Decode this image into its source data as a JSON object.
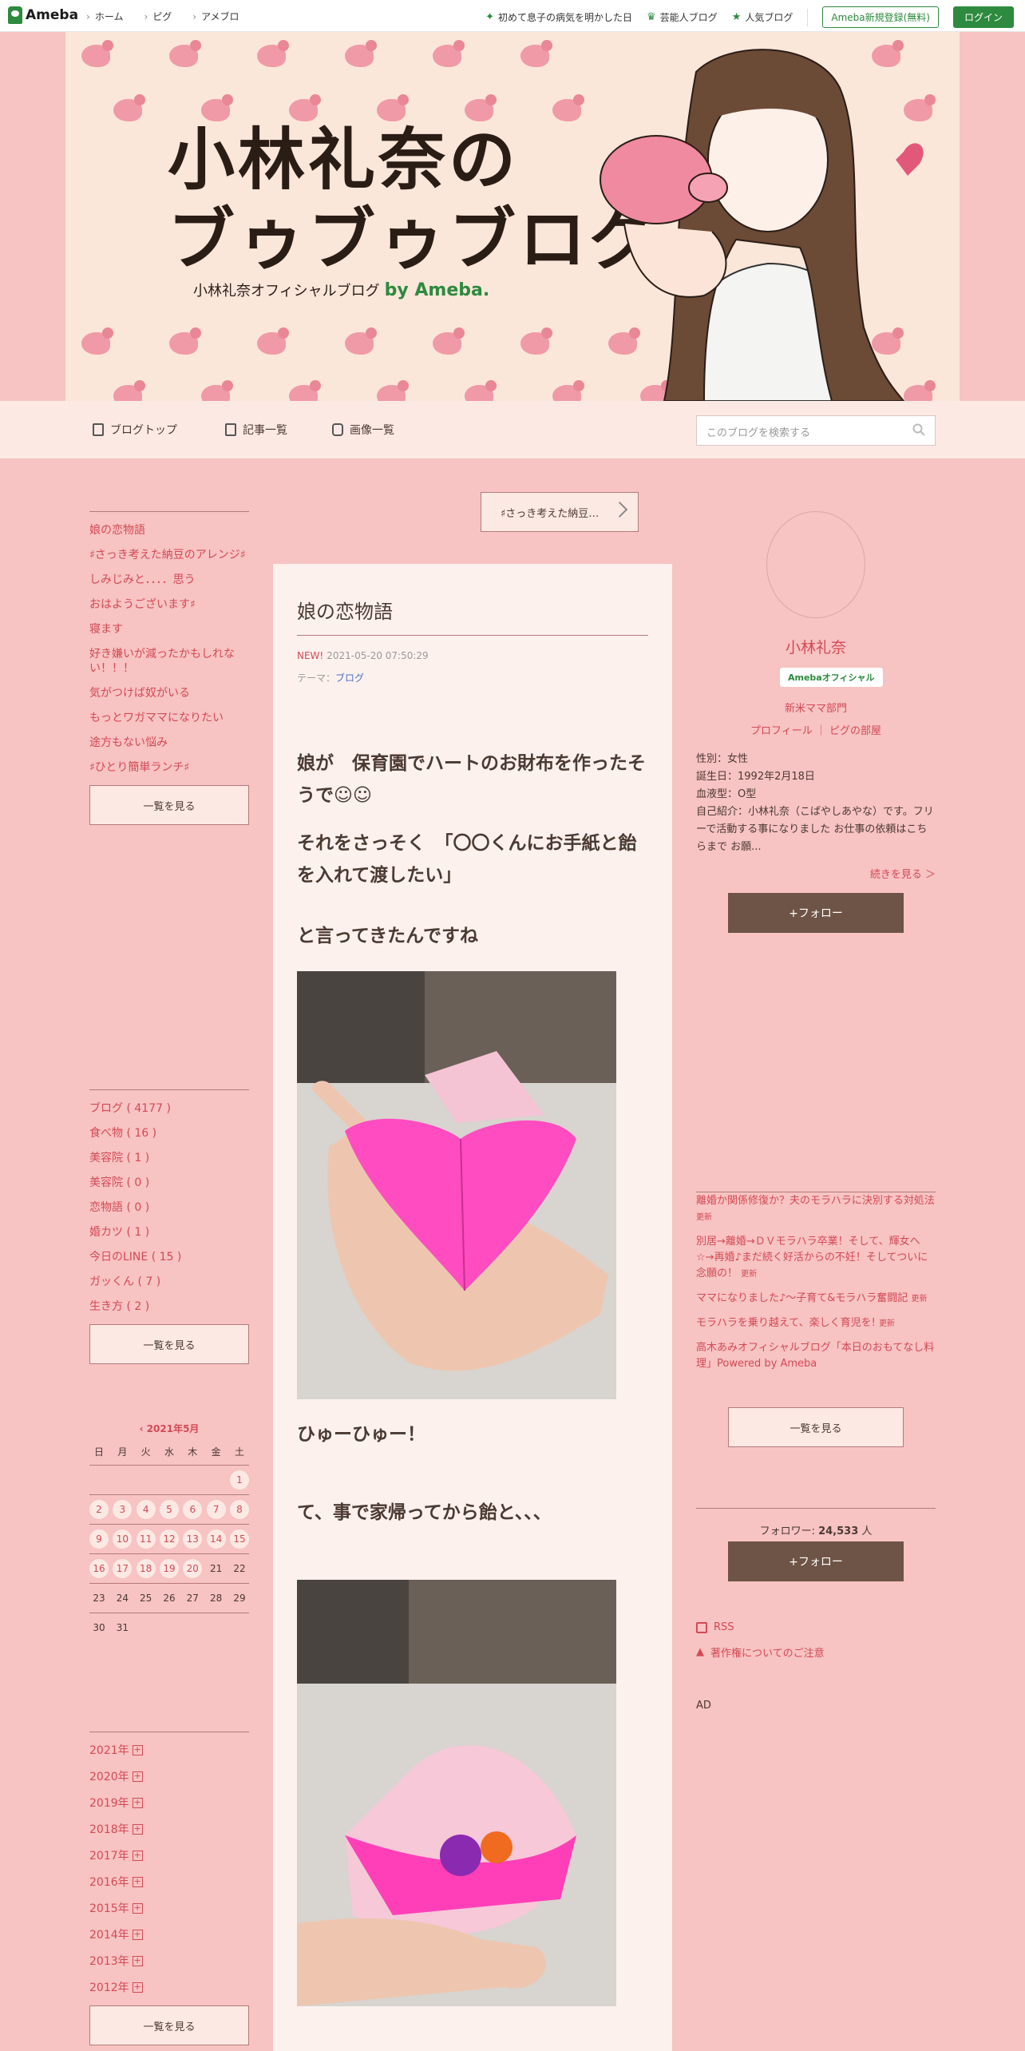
{
  "topbar": {
    "logo": "Ameba",
    "nav": [
      "ホーム",
      "ピグ",
      "アメブロ"
    ],
    "links": [
      "初めて息子の病気を明かした日",
      "芸能人ブログ",
      "人気ブログ"
    ],
    "register": "Ameba新規登録(無料)",
    "login": "ログイン"
  },
  "header": {
    "title_line1": "小林礼奈の",
    "title_line2": "ブゥブゥブログ",
    "subtitle": "小林礼奈オフィシャルブログ",
    "by": "by Ameba."
  },
  "nav": {
    "items": [
      "ブログトップ",
      "記事一覧",
      "画像一覧"
    ],
    "search_placeholder": "このブログを検索する"
  },
  "left": {
    "recent": [
      "娘の恋物語",
      "♯さっき考えた納豆のアレンジ♯",
      "しみじみと．．．．思う",
      "おはようございます♯",
      "寝ます",
      "好き嫌いが減ったかもしれない！！！",
      "気がつけば奴がいる",
      "もっとワガママになりたい",
      "途方もない悩み",
      "♯ひとり簡単ランチ♯"
    ],
    "more1": "一覧を見る",
    "themes": [
      "ブログ ( 4177 )",
      "食べ物 ( 16 )",
      "美容院 ( 1 )",
      "美容院 ( 0 )",
      "恋物語 ( 0 )",
      "婚カツ ( 1 )",
      "今日のLINE ( 15 )",
      "ガッくん ( 7 )",
      "生き方 ( 2 )"
    ],
    "more2": "一覧を見る",
    "calendar": {
      "title": "2021年5月",
      "days": [
        "日",
        "月",
        "火",
        "水",
        "木",
        "金",
        "土"
      ],
      "weeks": [
        [
          "",
          "",
          "",
          "",
          "",
          "",
          "1"
        ],
        [
          "2",
          "3",
          "4",
          "5",
          "6",
          "7",
          "8"
        ],
        [
          "9",
          "10",
          "11",
          "12",
          "13",
          "14",
          "15"
        ],
        [
          "16",
          "17",
          "18",
          "19",
          "20",
          "21",
          "22"
        ],
        [
          "23",
          "24",
          "25",
          "26",
          "27",
          "28",
          "29"
        ],
        [
          "30",
          "31",
          "",
          "",
          "",
          "",
          ""
        ]
      ]
    },
    "archive": [
      "2021年",
      "2020年",
      "2019年",
      "2018年",
      "2017年",
      "2016年",
      "2015年",
      "2014年",
      "2013年",
      "2012年"
    ],
    "more3": "一覧を見る"
  },
  "main": {
    "pager": "♯さっき考えた納豆…",
    "title": "娘の恋物語",
    "new_label": "NEW!",
    "date": "2021-05-20 07:50:29",
    "theme_label": "テーマ：",
    "theme": "ブログ",
    "p1": "娘が　保育園でハートのお財布を作ったそうで☺☺",
    "p2": "それをさっそく　「〇〇くんにお手紙と飴を入れて渡したい」",
    "p3": "と言ってきたんですね",
    "p4": "ひゅーひゅー！",
    "p5": "て、事で家帰ってから飴と、、、"
  },
  "right": {
    "name": "小林礼奈",
    "badge": "Amebaオフィシャル",
    "genre": "新米ママ部門",
    "links": "プロフィール ｜ ピグの部屋",
    "profile": [
      "性別：女性",
      "誕生日：1992年2月18日",
      "血液型：O型",
      "自己紹介：小林礼奈（こばやしあやな）です。フリーで活動する事になりました お仕事の依頼はこちらまで お願..."
    ],
    "more": "続きを見る ＞",
    "follow": "+フォロー",
    "recommend": [
      {
        "t": "離婚か関係修復か？夫のモラハラに決別する対処法",
        "u": "更新"
      },
      {
        "t": "別居→離婚→ＤＶモラハラ卒業！そして、輝女へ☆→再婚♪まだ続く好活からの不妊！そしてついに念願の！",
        "u": "更新"
      },
      {
        "t": "ママになりました♪～子育て&モラハラ奮闘記",
        "u": "更新"
      },
      {
        "t": "モラハラを乗り越えて、楽しく育児を!",
        "u": "更新"
      },
      {
        "t": "高木あみオフィシャルブログ「本日のおもてなし料理」Powered by Ameba",
        "u": ""
      }
    ],
    "more_btn": "一覧を見る",
    "followers_label": "フォロワー:",
    "followers": "24,533",
    "followers_unit": "人",
    "follow2": "+フォロー",
    "rss": "RSS",
    "copyright": "著作権についてのご注意",
    "ad": "AD"
  }
}
